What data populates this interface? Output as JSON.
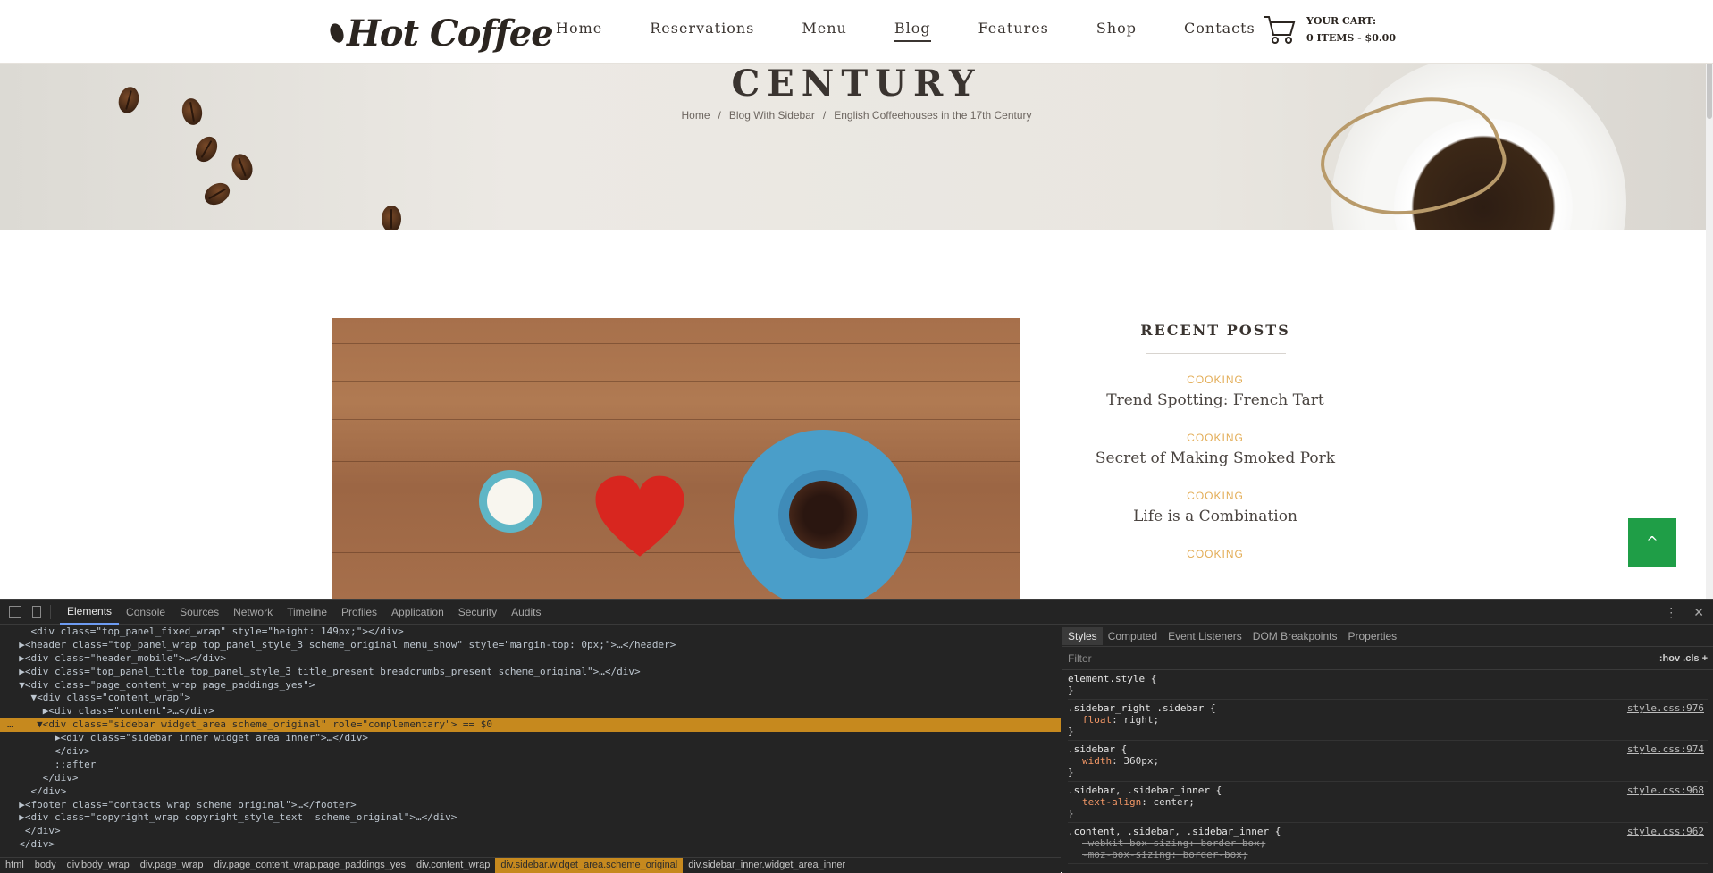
{
  "site": {
    "logo_text": "Hot Coffee",
    "nav": [
      "Home",
      "Reservations",
      "Menu",
      "Blog",
      "Features",
      "Shop",
      "Contacts"
    ],
    "active_nav": "Blog",
    "cart": {
      "line1": "YOUR CART:",
      "line2": "0 ITEMS - $0.00"
    }
  },
  "hero": {
    "title": "CENTURY",
    "breadcrumbs": [
      "Home",
      "Blog With Sidebar",
      "English Coffeehouses in the 17th Century"
    ],
    "separator": "/"
  },
  "sidebar": {
    "widget_title": "RECENT POSTS",
    "posts": [
      {
        "category": "COOKING",
        "title": "Trend Spotting: French Tart"
      },
      {
        "category": "COOKING",
        "title": "Secret of Making Smoked Pork"
      },
      {
        "category": "COOKING",
        "title": "Life is a Combination"
      },
      {
        "category": "COOKING",
        "title": ""
      }
    ]
  },
  "to_top": {
    "label": "^"
  },
  "devtools": {
    "tabs": [
      "Elements",
      "Console",
      "Sources",
      "Network",
      "Timeline",
      "Profiles",
      "Application",
      "Security",
      "Audits"
    ],
    "active_tab": "Elements",
    "elements_lines": [
      "    <div class=\"top_panel_fixed_wrap\" style=\"height: 149px;\"></div>",
      "  ▶<header class=\"top_panel_wrap top_panel_style_3 scheme_original menu_show\" style=\"margin-top: 0px;\">…</header>",
      "  ▶<div class=\"header_mobile\">…</div>",
      "  ▶<div class=\"top_panel_title top_panel_style_3 title_present breadcrumbs_present scheme_original\">…</div>",
      "  ▼<div class=\"page_content_wrap page_paddings_yes\">",
      "    ▼<div class=\"content_wrap\">",
      "      ▶<div class=\"content\">…</div>",
      "…    ▼<div class=\"sidebar widget_area scheme_original\" role=\"complementary\"> == $0",
      "        ▶<div class=\"sidebar_inner widget_area_inner\">…</div>",
      "        </div>",
      "        ::after",
      "      </div>",
      "    </div>",
      "  ▶<footer class=\"contacts_wrap scheme_original\">…</footer>",
      "  ▶<div class=\"copyright_wrap copyright_style_text  scheme_original\">…</div>",
      "   </div>",
      "  </div>"
    ],
    "selected_line_index": 7,
    "dom_breadcrumbs": [
      "html",
      "body",
      "div.body_wrap",
      "div.page_wrap",
      "div.page_content_wrap.page_paddings_yes",
      "div.content_wrap",
      "div.sidebar.widget_area.scheme_original",
      "div.sidebar_inner.widget_area_inner"
    ],
    "active_dom_breadcrumb": "div.sidebar.widget_area.scheme_original",
    "style_tabs": [
      "Styles",
      "Computed",
      "Event Listeners",
      "DOM Breakpoints",
      "Properties"
    ],
    "active_style_tab": "Styles",
    "filter_placeholder": "Filter",
    "filter_tools": ":hov  .cls  +",
    "rules": [
      {
        "selector": "element.style {",
        "source": "",
        "props": []
      },
      {
        "selector": ".sidebar_right .sidebar {",
        "source": "style.css:976",
        "props": [
          {
            "name": "float",
            "value": "right;",
            "struck": false
          }
        ]
      },
      {
        "selector": ".sidebar {",
        "source": "style.css:974",
        "props": [
          {
            "name": "width",
            "value": "360px;",
            "struck": false
          }
        ]
      },
      {
        "selector": ".sidebar, .sidebar_inner {",
        "source": "style.css:968",
        "props": [
          {
            "name": "text-align",
            "value": "center;",
            "struck": false
          }
        ]
      },
      {
        "selector": ".content, .sidebar, .sidebar_inner {",
        "source": "style.css:962",
        "props": [
          {
            "name": "-webkit-box-sizing",
            "value": "border-box;",
            "struck": true
          },
          {
            "name": "-moz-box-sizing",
            "value": "border-box;",
            "struck": true
          }
        ]
      }
    ]
  },
  "colors": {
    "accent_green": "#1f9e47",
    "category_orange": "#e3ad57",
    "devtools_selection": "#c6891e"
  }
}
